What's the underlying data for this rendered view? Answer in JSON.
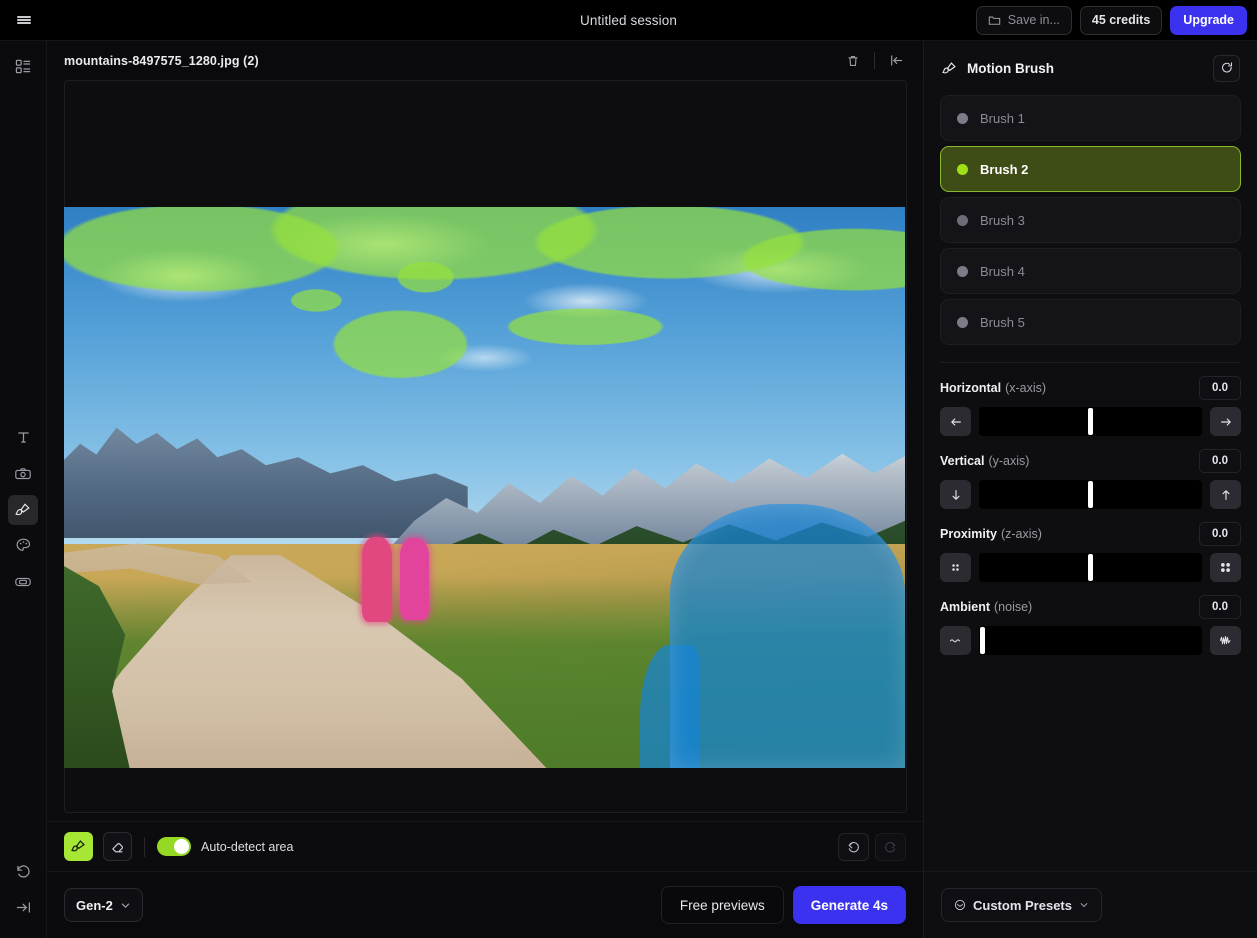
{
  "topbar": {
    "menu_icon": "hamburger-menu-icon",
    "session_title": "Untitled session",
    "save_in_label": "Save in...",
    "save_in_icon": "folder-icon",
    "credits_label": "45 credits",
    "upgrade_label": "Upgrade",
    "accent_color": "#3b32f0"
  },
  "rail": {
    "items": [
      {
        "name": "assets-grid-icon",
        "label": "Assets"
      },
      {
        "name": "text-tool-icon",
        "label": "Text"
      },
      {
        "name": "camera-tool-icon",
        "label": "Camera"
      },
      {
        "name": "motion-brush-tool-icon",
        "label": "Motion Brush"
      },
      {
        "name": "palette-tool-icon",
        "label": "Style"
      },
      {
        "name": "frame-tool-icon",
        "label": "Frame"
      },
      {
        "name": "history-reset-icon",
        "label": "Reset"
      },
      {
        "name": "collapse-panel-icon",
        "label": "Collapse"
      }
    ],
    "active": "motion-brush-tool-icon"
  },
  "canvas": {
    "filename": "mountains-8497575_1280.jpg (2)",
    "delete_icon": "trash-icon",
    "collapse_icon": "collapse-left-icon",
    "image_alt": "Mountain meadow path with two walkers, green mask on clouds, blue mask on foliage, magenta mask on walkers",
    "mask_colors": {
      "green": "#96e13c",
      "blue": "#1684d6",
      "magenta": "#e0487f"
    }
  },
  "brushbar": {
    "brush_tool_label": "Brush",
    "brush_tool_icon": "paintbrush-icon",
    "eraser_tool_label": "Eraser",
    "eraser_tool_icon": "eraser-icon",
    "autodetect_label": "Auto-detect area",
    "autodetect_on": true,
    "toggle_color": "#96d925",
    "undo_icon": "undo-icon",
    "redo_icon": "redo-icon"
  },
  "footer": {
    "model_label": "Gen-2",
    "model_chevron": "chevron-down-icon",
    "free_previews_label": "Free previews",
    "generate_label": "Generate 4s"
  },
  "panel": {
    "title": "Motion Brush",
    "title_icon": "paintbrush-icon",
    "reset_icon": "reset-icon",
    "brushes": [
      {
        "label": "Brush 1",
        "selected": false,
        "dot": "#7c7c88"
      },
      {
        "label": "Brush 2",
        "selected": true,
        "dot": "#9ee016"
      },
      {
        "label": "Brush 3",
        "selected": false,
        "dot": "#6d6d79"
      },
      {
        "label": "Brush 4",
        "selected": false,
        "dot": "#7c7c88"
      },
      {
        "label": "Brush 5",
        "selected": false,
        "dot": "#7c7c88"
      }
    ],
    "sliders": [
      {
        "name": "Horizontal",
        "sub": "(x-axis)",
        "value": "0.0",
        "pos": 50,
        "left_icon": "arrow-left-icon",
        "right_icon": "arrow-right-icon"
      },
      {
        "name": "Vertical",
        "sub": "(y-axis)",
        "value": "0.0",
        "pos": 50,
        "left_icon": "arrow-down-icon",
        "right_icon": "arrow-up-icon"
      },
      {
        "name": "Proximity",
        "sub": "(z-axis)",
        "value": "0.0",
        "pos": 50,
        "left_icon": "zoom-out-dots-icon",
        "right_icon": "zoom-in-dots-icon"
      },
      {
        "name": "Ambient",
        "sub": "(noise)",
        "value": "0.0",
        "pos": 0,
        "left_icon": "flat-wave-icon",
        "right_icon": "noisy-wave-icon"
      }
    ],
    "presets_label": "Custom Presets",
    "presets_icon": "presets-icon",
    "presets_chevron": "chevron-down-icon"
  }
}
